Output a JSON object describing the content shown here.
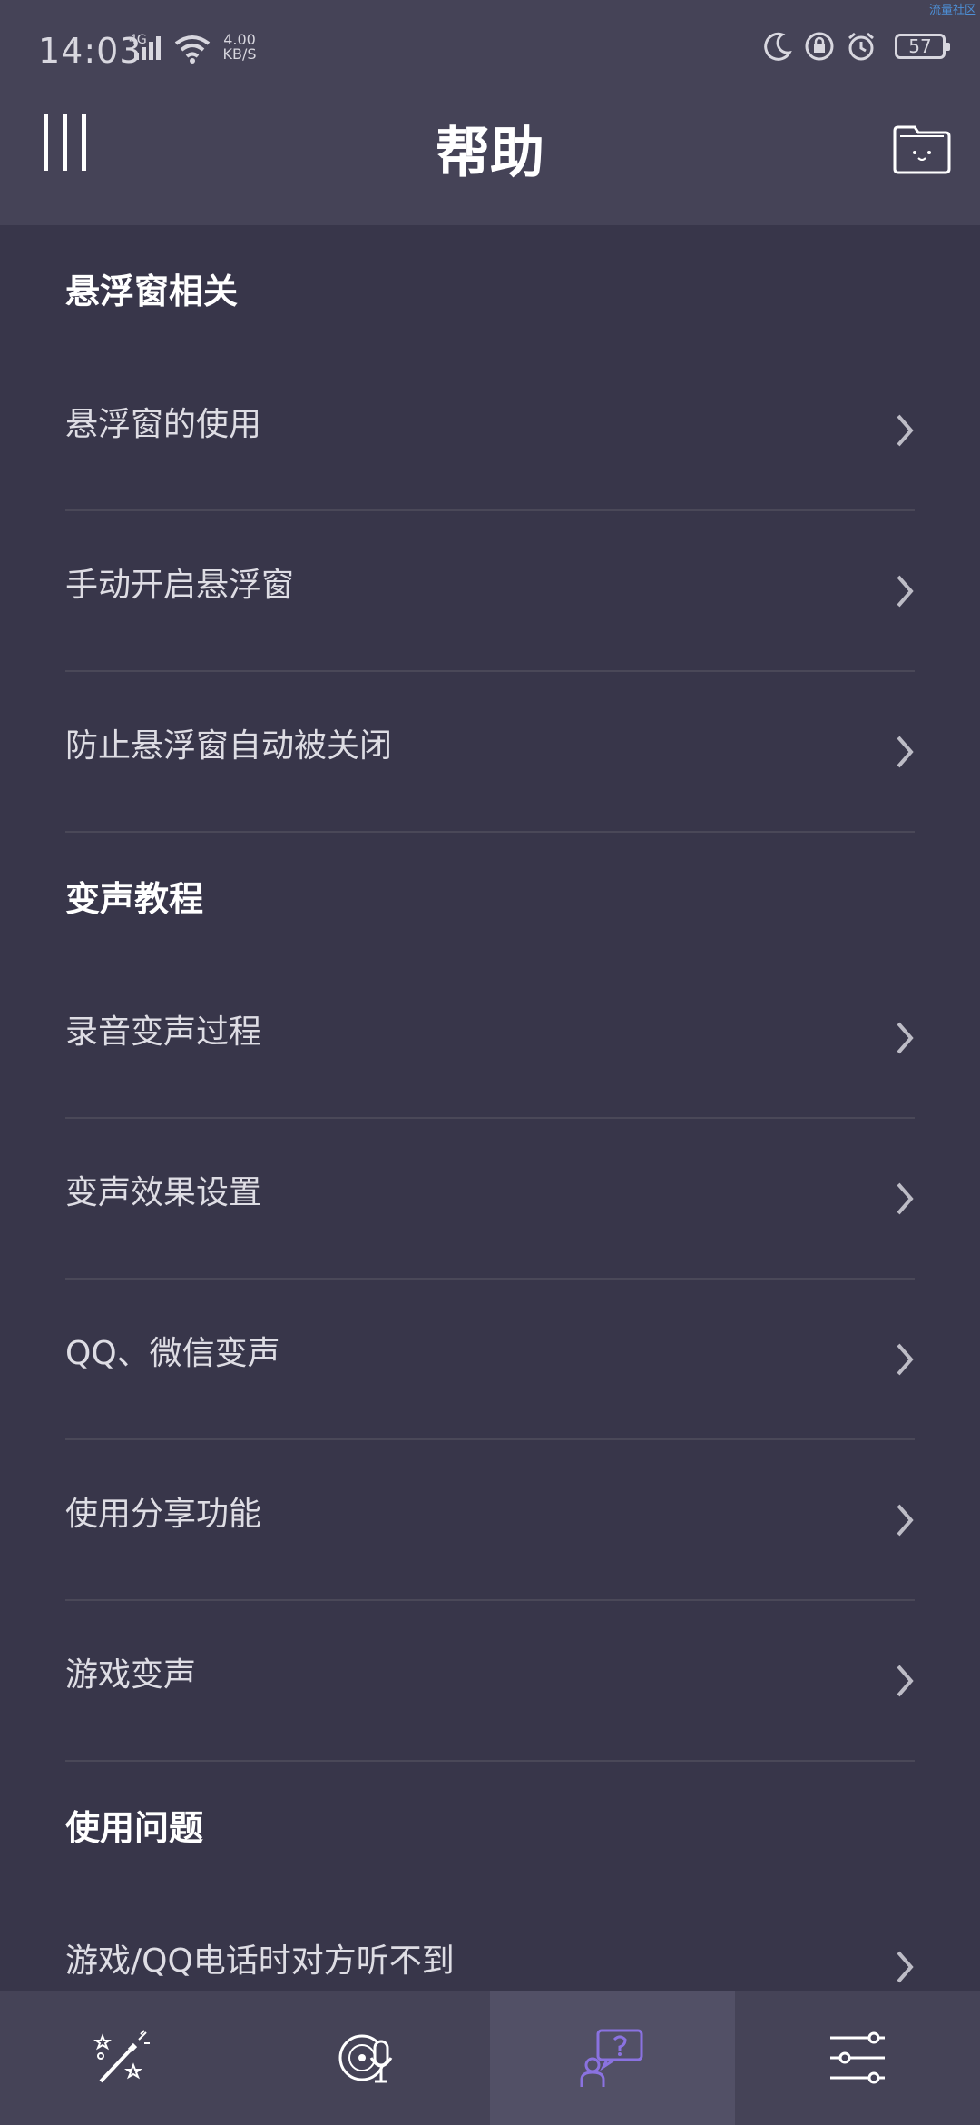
{
  "status_bar": {
    "time": "14:03",
    "network": "4G",
    "speed_value": "4.00",
    "speed_unit": "KB/S",
    "battery": "57",
    "corner_text": "流量社区"
  },
  "header": {
    "title": "帮助"
  },
  "sections": [
    {
      "title": "悬浮窗相关",
      "items": [
        "悬浮窗的使用",
        "手动开启悬浮窗",
        "防止悬浮窗自动被关闭"
      ]
    },
    {
      "title": "变声教程",
      "items": [
        "录音变声过程",
        "变声效果设置",
        "QQ、微信变声",
        "使用分享功能",
        "游戏变声"
      ]
    },
    {
      "title": "使用问题",
      "items": [
        "游戏/QQ电话时对方听不到"
      ]
    }
  ],
  "bottom_nav": [
    {
      "icon": "magic-wand-icon",
      "active": false
    },
    {
      "icon": "record-mic-icon",
      "active": false
    },
    {
      "icon": "help-person-icon",
      "active": true
    },
    {
      "icon": "settings-sliders-icon",
      "active": false
    }
  ],
  "colors": {
    "background": "#38364a",
    "bar": "#454357",
    "active_tab": "#525066",
    "accent": "#8a72e0"
  }
}
